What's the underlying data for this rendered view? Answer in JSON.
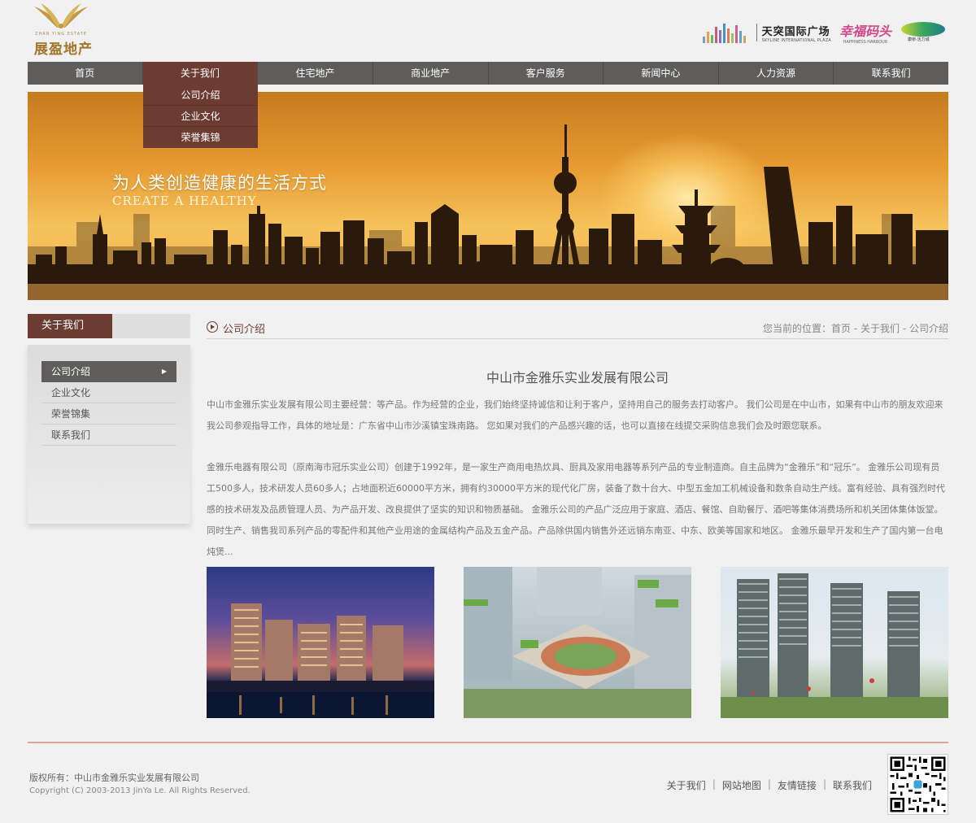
{
  "header": {
    "logo": {
      "name": "展盈地产",
      "sub": "ZHAN YING ESTATE"
    },
    "partners": [
      {
        "cn": "天突国际广场",
        "en": "SKYLINE INTERNATIONAL PLAZA"
      },
      {
        "cn": "幸福码头",
        "en": "HAPPINESS HARBOUR"
      },
      {
        "cn": "康桥·活力城"
      }
    ]
  },
  "nav": {
    "items": [
      {
        "label": "首页"
      },
      {
        "label": "关于我们"
      },
      {
        "label": "住宅地产"
      },
      {
        "label": "商业地产"
      },
      {
        "label": "客户服务"
      },
      {
        "label": "新闻中心"
      },
      {
        "label": "人力资源"
      },
      {
        "label": "联系我们"
      }
    ],
    "active_index": 1,
    "dropdown": [
      "公司介绍",
      "企业文化",
      "荣誉集锦"
    ]
  },
  "banner": {
    "title": "为人类创造健康的生活方式",
    "subtitle": "CREATE A HEALTHY"
  },
  "sidebar": {
    "title": "关于我们",
    "items": [
      {
        "label": "公司介绍"
      },
      {
        "label": "企业文化"
      },
      {
        "label": "荣誉锦集"
      },
      {
        "label": "联系我们"
      }
    ],
    "active_index": 0
  },
  "main": {
    "section_title": "公司介绍",
    "breadcrumb": {
      "prefix": "您当前的位置：",
      "items": [
        "首页",
        "关于我们",
        "公司介绍"
      ],
      "separator": " - "
    },
    "company_name": "中山市金雅乐实业发展有限公司",
    "paragraphs": [
      "中山市金雅乐实业发展有限公司主要经营：等产品。作为经营的企业，我们始终坚持诚信和让利于客户，坚持用自己的服务去打动客户。  我们公司是在中山市，如果有中山市的朋友欢迎来我公司参观指导工作，具体的地址是：广东省中山市沙溪镇宝珠南路。  您如果对我们的产品感兴趣的话，也可以直接在线提交采购信息我们会及时跟您联系。",
      "金雅乐电器有限公司（原南海市冠乐实业公司）创建于1992年，是一家生产商用电热炊具、厨具及家用电器等系列产品的专业制造商。自主品牌为“金雅乐”和“冠乐”。 金雅乐公司现有员工500多人，技术研发人员60多人；占地面积近60000平方米，拥有约30000平方米的现代化厂房，装备了数十台大、中型五金加工机械设备和数条自动生产线。富有经验、具有强烈时代感的技术研发及品质管理人员、为产品开发、改良提供了坚实的知识和物质基础。 金雅乐公司的产品广泛应用于家庭、酒店、餐馆、自助餐厅、酒吧等集体消费场所和机关团体集体饭堂。同时生产、销售我司系列产品的零配件和其他产业用途的金属结构产品及五金产品。产品除供国内销售外还远销东南亚、中东、欧美等国家和地区。 金雅乐最早开发和生产了国内第一台电炖煲..."
    ]
  },
  "footer": {
    "copyright_cn": "版权所有：中山市金雅乐实业发展有限公司",
    "copyright_en": "Copyright (C) 2003-2013 JinYa Le. All Rights Reserved.",
    "links": [
      "关于我们",
      "网站地图",
      "友情链接",
      "联系我们"
    ],
    "link_separator": "|"
  },
  "colors": {
    "nav_bg": "#5e5d5c",
    "accent": "#6c3b32",
    "footer_line": "#d5a794"
  }
}
